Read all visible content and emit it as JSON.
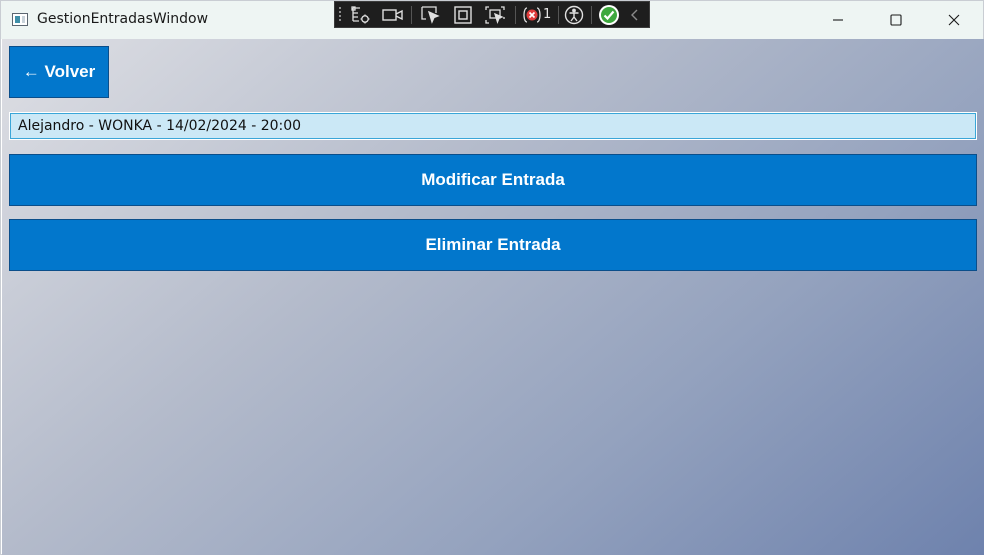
{
  "window": {
    "title": "GestionEntradasWindow"
  },
  "debug_toolbar": {
    "issue_count": "1"
  },
  "main": {
    "back_button_label": "← Volver",
    "selected_entry": "Alejandro - WONKA - 14/02/2024 - 20:00",
    "modify_button_label": "Modificar Entrada",
    "delete_button_label": "Eliminar Entrada"
  },
  "colors": {
    "button_primary": "#0277cc",
    "entry_field_bg": "#cbe8f6",
    "titlebar_bg": "#eef5f3",
    "debugbar_bg": "#1e1e1e"
  }
}
